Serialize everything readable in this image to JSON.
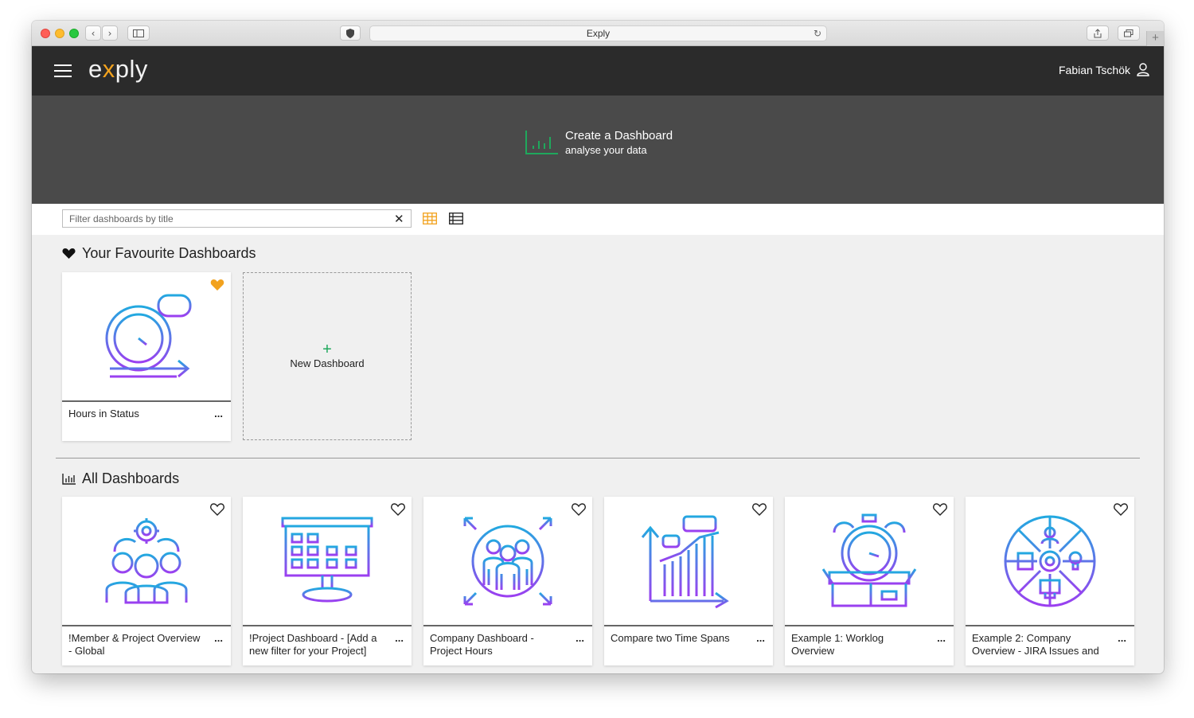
{
  "browser": {
    "address": "Exply"
  },
  "header": {
    "logo_pre": "e",
    "logo_x": "x",
    "logo_post": "ply",
    "user_name": "Fabian Tschök"
  },
  "hero": {
    "title": "Create a Dashboard",
    "subtitle": "analyse your data"
  },
  "filter": {
    "placeholder": "Filter dashboards by title",
    "value": ""
  },
  "favourites": {
    "title": "Your Favourite Dashboards",
    "cards": [
      {
        "label": "Hours in Status",
        "icon": "clock-arrow-icon",
        "favourite": true
      }
    ],
    "new_label": "New Dashboard",
    "new_symbol": "+"
  },
  "all": {
    "title": "All Dashboards",
    "cards": [
      {
        "label": "!Member & Project Overview - Global",
        "icon": "team-gear-icon"
      },
      {
        "label": "!Project Dashboard - [Add a new filter for your Project]",
        "icon": "kanban-monitor-icon"
      },
      {
        "label": "Company Dashboard - Project Hours",
        "icon": "group-expand-icon"
      },
      {
        "label": "Compare two Time Spans",
        "icon": "growth-chart-icon"
      },
      {
        "label": "Example 1: Worklog Overview",
        "icon": "alarm-box-icon"
      },
      {
        "label": "Example 2: Company Overview - JIRA Issues and",
        "icon": "company-wheel-icon"
      }
    ]
  },
  "more_label": "...",
  "colors": {
    "accent_orange": "#f2a21e",
    "accent_green": "#1fa85c",
    "header_bg": "#2b2b2b",
    "hero_bg": "#4a4a4a",
    "icon_gradient_start": "#22a9e0",
    "icon_gradient_end": "#9b3ff0"
  }
}
